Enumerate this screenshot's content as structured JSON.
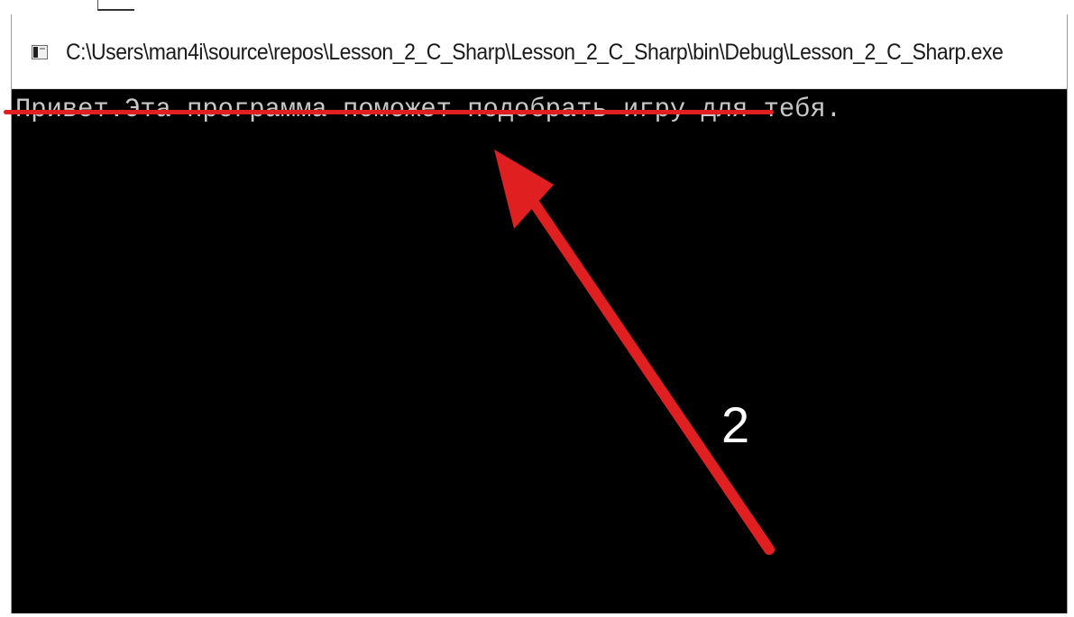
{
  "window": {
    "title": "C:\\Users\\man4i\\source\\repos\\Lesson_2_C_Sharp\\Lesson_2_C_Sharp\\bin\\Debug\\Lesson_2_C_Sharp.exe",
    "icon": "console-app-icon"
  },
  "console": {
    "output_line": "Привет.Эта программа поможет подобрать игру для тебя."
  },
  "annotation": {
    "step_number": "2",
    "color": "#e02020"
  }
}
